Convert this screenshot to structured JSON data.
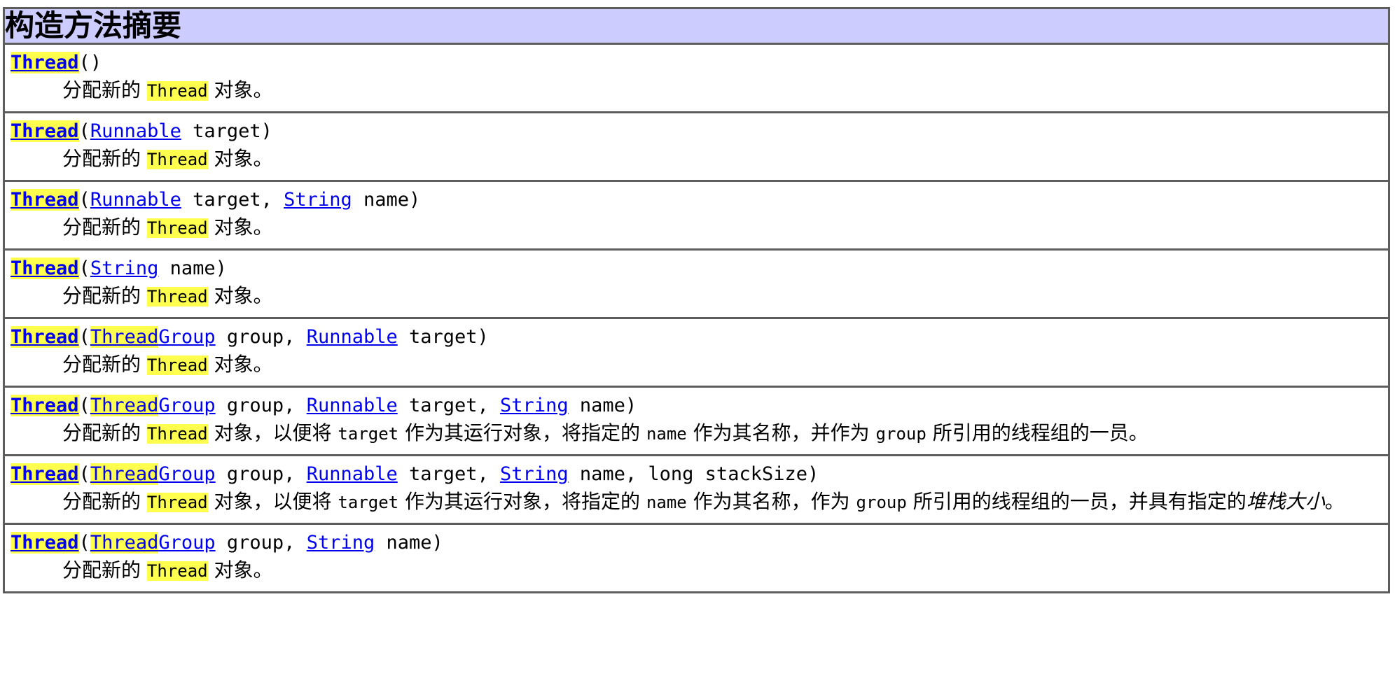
{
  "page": {
    "heading": "构造方法摘要",
    "heading_bg": "#ccccff",
    "link_color": "#0000ee",
    "highlight_color": "#ffff4d",
    "border_color": "#5d5d5d"
  },
  "rows": [
    {
      "id": "thread-noarg",
      "signature": {
        "name": "Thread",
        "open_paren": "(",
        "params": [],
        "close_paren": ")"
      },
      "description": {
        "prefix": "分配新的 ",
        "code": "Thread",
        "suffix": " 对象。"
      }
    },
    {
      "id": "thread-runnable",
      "signature": {
        "name": "Thread",
        "open_paren": "(",
        "params": [
          {
            "type": "Runnable",
            "type_is_link": true,
            "var": "target",
            "sep": ""
          }
        ],
        "close_paren": ")"
      },
      "description": {
        "prefix": "分配新的 ",
        "code": "Thread",
        "suffix": " 对象。"
      }
    },
    {
      "id": "thread-runnable-string",
      "signature": {
        "name": "Thread",
        "open_paren": "(",
        "params": [
          {
            "type": "Runnable",
            "type_is_link": true,
            "var": "target",
            "sep": ", "
          },
          {
            "type": "String",
            "type_is_link": true,
            "var": "name",
            "sep": ""
          }
        ],
        "close_paren": ")"
      },
      "description": {
        "prefix": "分配新的 ",
        "code": "Thread",
        "suffix": " 对象。"
      }
    },
    {
      "id": "thread-string",
      "signature": {
        "name": "Thread",
        "open_paren": "(",
        "params": [
          {
            "type": "String",
            "type_is_link": true,
            "var": "name",
            "sep": ""
          }
        ],
        "close_paren": ")"
      },
      "description": {
        "prefix": "分配新的 ",
        "code": "Thread",
        "suffix": " 对象。"
      }
    },
    {
      "id": "thread-group-runnable",
      "signature": {
        "name": "Thread",
        "open_paren": "(",
        "params": [
          {
            "type": "ThreadGroup",
            "type_is_link": true,
            "var": "group",
            "sep": ", "
          },
          {
            "type": "Runnable",
            "type_is_link": true,
            "var": "target",
            "sep": ""
          }
        ],
        "close_paren": ")"
      },
      "description": {
        "prefix": "分配新的 ",
        "code": "Thread",
        "suffix": " 对象。"
      }
    },
    {
      "id": "thread-group-runnable-string",
      "signature": {
        "name": "Thread",
        "open_paren": "(",
        "params": [
          {
            "type": "ThreadGroup",
            "type_is_link": true,
            "var": "group",
            "sep": ", "
          },
          {
            "type": "Runnable",
            "type_is_link": true,
            "var": "target",
            "sep": ", "
          },
          {
            "type": "String",
            "type_is_link": true,
            "var": "name",
            "sep": ""
          }
        ],
        "close_paren": ")"
      },
      "description_long": {
        "segments": [
          {
            "kind": "text",
            "text": "分配新的 "
          },
          {
            "kind": "code-hl",
            "text": "Thread"
          },
          {
            "kind": "text",
            "text": " 对象，以便将 "
          },
          {
            "kind": "code",
            "text": "target"
          },
          {
            "kind": "text",
            "text": " 作为其运行对象，将指定的 "
          },
          {
            "kind": "code",
            "text": "name"
          },
          {
            "kind": "text",
            "text": " 作为其名称，并作为 "
          },
          {
            "kind": "code",
            "text": "group"
          },
          {
            "kind": "text",
            "text": " 所引用的线程组的一员。"
          }
        ]
      }
    },
    {
      "id": "thread-group-runnable-string-stacksize",
      "signature": {
        "name": "Thread",
        "open_paren": "(",
        "params": [
          {
            "type": "ThreadGroup",
            "type_is_link": true,
            "var": "group",
            "sep": ", "
          },
          {
            "type": "Runnable",
            "type_is_link": true,
            "var": "target",
            "sep": ", "
          },
          {
            "type": "String",
            "type_is_link": true,
            "var": "name",
            "sep": ", "
          },
          {
            "type": "long",
            "type_is_link": false,
            "var": "stackSize",
            "sep": ""
          }
        ],
        "close_paren": ")"
      },
      "description_long": {
        "segments": [
          {
            "kind": "text",
            "text": "分配新的 "
          },
          {
            "kind": "code-hl",
            "text": "Thread"
          },
          {
            "kind": "text",
            "text": " 对象，以便将 "
          },
          {
            "kind": "code",
            "text": "target"
          },
          {
            "kind": "text",
            "text": " 作为其运行对象，将指定的 "
          },
          {
            "kind": "code",
            "text": "name"
          },
          {
            "kind": "text",
            "text": " 作为其名称，作为 "
          },
          {
            "kind": "code",
            "text": "group"
          },
          {
            "kind": "text",
            "text": " 所引用的线程组的一员，并具有指定的"
          },
          {
            "kind": "italic",
            "text": "堆栈大小"
          },
          {
            "kind": "text",
            "text": "。"
          }
        ]
      }
    },
    {
      "id": "thread-group-string",
      "signature": {
        "name": "Thread",
        "open_paren": "(",
        "params": [
          {
            "type": "ThreadGroup",
            "type_is_link": true,
            "var": "group",
            "sep": ", "
          },
          {
            "type": "String",
            "type_is_link": true,
            "var": "name",
            "sep": ""
          }
        ],
        "close_paren": ")"
      },
      "description": {
        "prefix": "分配新的 ",
        "code": "Thread",
        "suffix": " 对象。"
      }
    }
  ]
}
